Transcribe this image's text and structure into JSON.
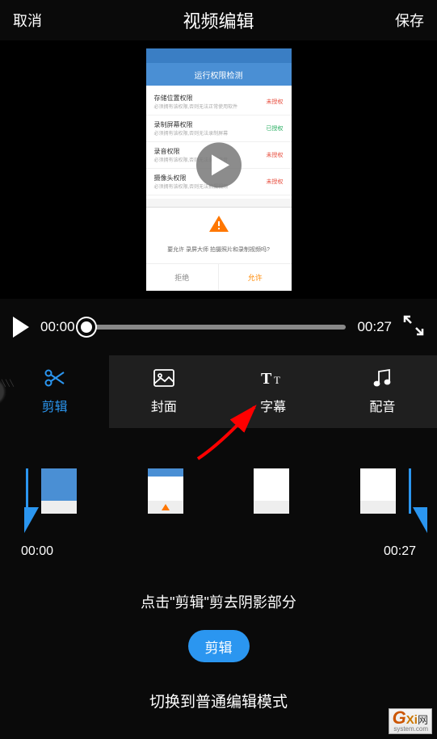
{
  "header": {
    "cancel": "取消",
    "title": "视频编辑",
    "save": "保存"
  },
  "preview": {
    "mock_header": "运行权限检测",
    "items": [
      {
        "title": "存储位置权限",
        "sub": "必须拥有该权限,否则无法正常使用软件",
        "tag": "未授权",
        "tagClass": ""
      },
      {
        "title": "录制屏幕权限",
        "sub": "必须拥有该权限,否则无法录制屏幕",
        "tag": "已授权",
        "tagClass": "green"
      },
      {
        "title": "录音权限",
        "sub": "必须拥有该权限,否则无法录制声音",
        "tag": "未授权",
        "tagClass": ""
      },
      {
        "title": "摄像头权限",
        "sub": "必须拥有该权限,否则无法拍摄视频",
        "tag": "未授权",
        "tagClass": ""
      }
    ],
    "dialog_text": "要允许 录屏大师 拍摄照片和录制视频吗?",
    "dialog_deny": "拒绝",
    "dialog_allow": "允许"
  },
  "playback": {
    "current": "00:00",
    "total": "00:27"
  },
  "tabs": {
    "trim": "剪辑",
    "cover": "封面",
    "subtitle": "字幕",
    "audio": "配音"
  },
  "timeline": {
    "start": "00:00",
    "end": "00:27"
  },
  "hint": "点击\"剪辑\"剪去阴影部分",
  "action_button": "剪辑",
  "mode_switch": "切换到普通编辑模式",
  "watermark": {
    "g": "G",
    "xi": "Xi",
    "net": "网",
    "url": "system.com"
  }
}
